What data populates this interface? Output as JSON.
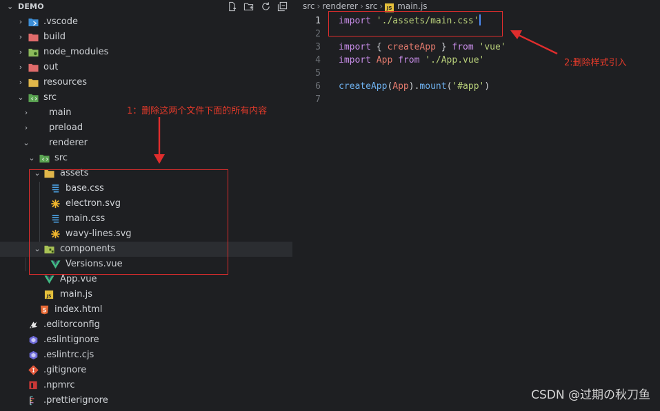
{
  "explorer": {
    "title": "DEMO",
    "header_icons": [
      "new-file-icon",
      "new-folder-icon",
      "refresh-icon",
      "collapse-all-icon"
    ],
    "items": [
      {
        "label": ".vscode",
        "icon": "vscode-folder-icon",
        "arrow": "›"
      },
      {
        "label": "build",
        "icon": "folder-red-icon",
        "arrow": "›"
      },
      {
        "label": "node_modules",
        "icon": "folder-green-icon",
        "arrow": "›"
      },
      {
        "label": "out",
        "icon": "folder-red-icon",
        "arrow": "›"
      },
      {
        "label": "resources",
        "icon": "folder-yellow-icon",
        "arrow": "›"
      },
      {
        "label": "src",
        "icon": "folder-src-icon",
        "arrow": "⌄"
      },
      {
        "label": "main",
        "icon": "",
        "arrow": "›"
      },
      {
        "label": "preload",
        "icon": "",
        "arrow": "›"
      },
      {
        "label": "renderer",
        "icon": "",
        "arrow": "⌄"
      },
      {
        "label": "src",
        "icon": "folder-src-icon",
        "arrow": "⌄"
      },
      {
        "label": "assets",
        "icon": "folder-yellow-icon",
        "arrow": "⌄"
      },
      {
        "label": "base.css",
        "icon": "css-icon",
        "arrow": ""
      },
      {
        "label": "electron.svg",
        "icon": "svg-icon",
        "arrow": ""
      },
      {
        "label": "main.css",
        "icon": "css-icon",
        "arrow": ""
      },
      {
        "label": "wavy-lines.svg",
        "icon": "svg-icon",
        "arrow": ""
      },
      {
        "label": "components",
        "icon": "folder-components-icon",
        "arrow": "⌄"
      },
      {
        "label": "Versions.vue",
        "icon": "vue-icon",
        "arrow": ""
      },
      {
        "label": "App.vue",
        "icon": "vue-icon",
        "arrow": ""
      },
      {
        "label": "main.js",
        "icon": "js-icon",
        "arrow": ""
      },
      {
        "label": "index.html",
        "icon": "html-icon",
        "arrow": ""
      },
      {
        "label": ".editorconfig",
        "icon": "editorconfig-icon",
        "arrow": ""
      },
      {
        "label": ".eslintignore",
        "icon": "eslint-icon",
        "arrow": ""
      },
      {
        "label": ".eslintrc.cjs",
        "icon": "eslint-icon",
        "arrow": ""
      },
      {
        "label": ".gitignore",
        "icon": "git-icon",
        "arrow": ""
      },
      {
        "label": ".npmrc",
        "icon": "npm-icon",
        "arrow": ""
      },
      {
        "label": ".prettierignore",
        "icon": "prettier-icon",
        "arrow": ""
      }
    ]
  },
  "editor": {
    "breadcrumb": [
      "src",
      "renderer",
      "src",
      "main.js"
    ],
    "js_badge": "JS",
    "lines": [
      {
        "n": "1",
        "tokens": [
          {
            "t": "import",
            "c": "kw"
          },
          {
            "t": " ",
            "c": "punc"
          },
          {
            "t": "'./assets/main.css'",
            "c": "str"
          }
        ]
      },
      {
        "n": "2",
        "tokens": []
      },
      {
        "n": "3",
        "tokens": [
          {
            "t": "import",
            "c": "kw"
          },
          {
            "t": " { ",
            "c": "punc"
          },
          {
            "t": "createApp",
            "c": "id"
          },
          {
            "t": " } ",
            "c": "punc"
          },
          {
            "t": "from",
            "c": "kw"
          },
          {
            "t": " ",
            "c": "punc"
          },
          {
            "t": "'vue'",
            "c": "str"
          }
        ]
      },
      {
        "n": "4",
        "tokens": [
          {
            "t": "import",
            "c": "kw"
          },
          {
            "t": " ",
            "c": "punc"
          },
          {
            "t": "App",
            "c": "id"
          },
          {
            "t": " ",
            "c": "punc"
          },
          {
            "t": "from",
            "c": "kw"
          },
          {
            "t": " ",
            "c": "punc"
          },
          {
            "t": "'./App.vue'",
            "c": "str"
          }
        ]
      },
      {
        "n": "5",
        "tokens": []
      },
      {
        "n": "6",
        "tokens": [
          {
            "t": "createApp",
            "c": "fn"
          },
          {
            "t": "(",
            "c": "punc"
          },
          {
            "t": "App",
            "c": "id"
          },
          {
            "t": ").",
            "c": "punc"
          },
          {
            "t": "mount",
            "c": "fn"
          },
          {
            "t": "(",
            "c": "punc"
          },
          {
            "t": "'#app'",
            "c": "str"
          },
          {
            "t": ")",
            "c": "punc"
          }
        ]
      },
      {
        "n": "7",
        "tokens": []
      }
    ]
  },
  "annotations": {
    "note1": "1：删除这两个文件下面的所有内容",
    "note2": "2:删除样式引入",
    "color": "#e33a2a"
  },
  "watermark": "CSDN @过期の秋刀鱼"
}
